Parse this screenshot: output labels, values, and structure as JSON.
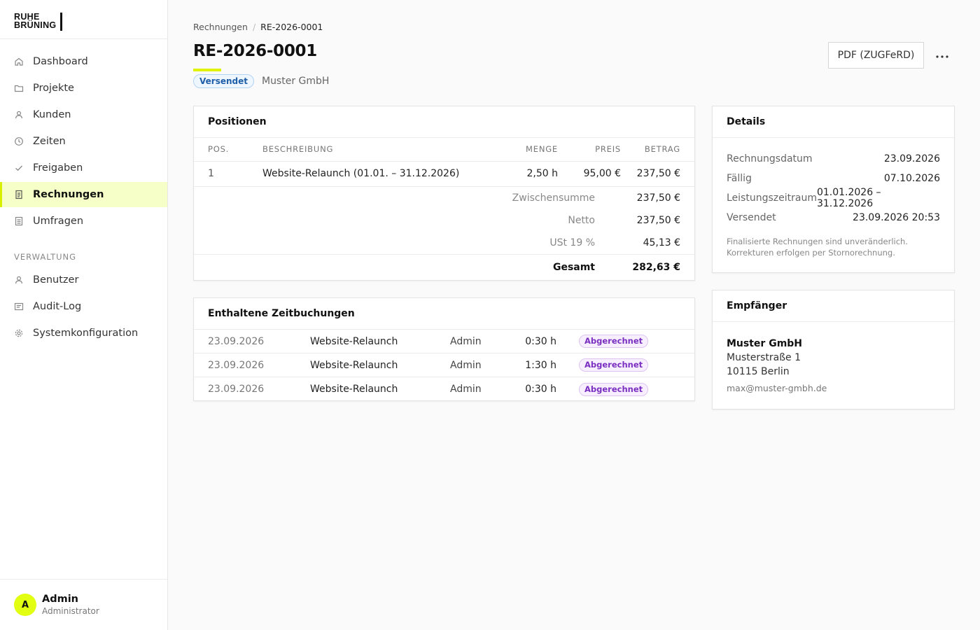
{
  "brand": {
    "line1": "RUHE",
    "line2": "BRÜNING"
  },
  "sidebar": {
    "items": [
      {
        "label": "Dashboard",
        "icon": "home-icon",
        "active": false
      },
      {
        "label": "Projekte",
        "icon": "folder-icon",
        "active": false
      },
      {
        "label": "Kunden",
        "icon": "user-icon",
        "active": false
      },
      {
        "label": "Zeiten",
        "icon": "clock-icon",
        "active": false
      },
      {
        "label": "Freigaben",
        "icon": "check-icon",
        "active": false
      },
      {
        "label": "Rechnungen",
        "icon": "document-icon",
        "active": true
      },
      {
        "label": "Umfragen",
        "icon": "list-icon",
        "active": false
      }
    ],
    "section_label": "VERWALTUNG",
    "admin_items": [
      {
        "label": "Benutzer",
        "icon": "user-icon"
      },
      {
        "label": "Audit-Log",
        "icon": "log-icon"
      },
      {
        "label": "Systemkonfiguration",
        "icon": "gear-icon"
      }
    ]
  },
  "user": {
    "initial": "A",
    "name": "Admin",
    "role": "Administrator"
  },
  "breadcrumb": {
    "parent": "Rechnungen",
    "separator": "/",
    "current": "RE-2026-0001"
  },
  "header": {
    "title": "RE-2026-0001",
    "status": "Versendet",
    "client": "Muster GmbH",
    "pdf_button": "PDF (ZUGFeRD)",
    "more_icon": "more-horizontal-icon"
  },
  "positions": {
    "title": "Positionen",
    "columns": {
      "pos": "POS.",
      "desc": "BESCHREIBUNG",
      "qty": "MENGE",
      "price": "PREIS",
      "amount": "BETRAG"
    },
    "rows": [
      {
        "pos": "1",
        "desc": "Website-Relaunch (01.01. – 31.12.2026)",
        "qty": "2,50 h",
        "price": "95,00 €",
        "amount": "237,50 €"
      }
    ],
    "totals": {
      "subtotal_label": "Zwischensumme",
      "subtotal": "237,50 €",
      "net_label": "Netto",
      "net": "237,50 €",
      "tax_label": "USt 19 %",
      "tax": "45,13 €",
      "total_label": "Gesamt",
      "total": "282,63 €"
    }
  },
  "entries": {
    "title": "Enthaltene Zeitbuchungen",
    "rows": [
      {
        "date": "23.09.2026",
        "project": "Website-Relaunch",
        "user": "Admin",
        "duration": "0:30 h",
        "status": "Abgerechnet"
      },
      {
        "date": "23.09.2026",
        "project": "Website-Relaunch",
        "user": "Admin",
        "duration": "1:30 h",
        "status": "Abgerechnet"
      },
      {
        "date": "23.09.2026",
        "project": "Website-Relaunch",
        "user": "Admin",
        "duration": "0:30 h",
        "status": "Abgerechnet"
      }
    ]
  },
  "details": {
    "title": "Details",
    "rows": [
      {
        "label": "Rechnungsdatum",
        "value": "23.09.2026"
      },
      {
        "label": "Fällig",
        "value": "07.10.2026"
      },
      {
        "label": "Leistungszeitraum",
        "value": "01.01.2026 – 31.12.2026"
      },
      {
        "label": "Versendet",
        "value": "23.09.2026 20:53"
      }
    ],
    "note_line1": "Finalisierte Rechnungen sind unveränderlich.",
    "note_line2": "Korrekturen erfolgen per Stornorechnung."
  },
  "recipient": {
    "title": "Empfänger",
    "name": "Muster GmbH",
    "street": "Musterstraße 1",
    "city": "10115 Berlin",
    "email": "max@muster-gmbh.de"
  },
  "colors": {
    "accent": "#e2ff12",
    "active_bg": "#f6ffc7",
    "sent_badge": "#1f5fa8",
    "billed_badge": "#7a2fc0"
  }
}
